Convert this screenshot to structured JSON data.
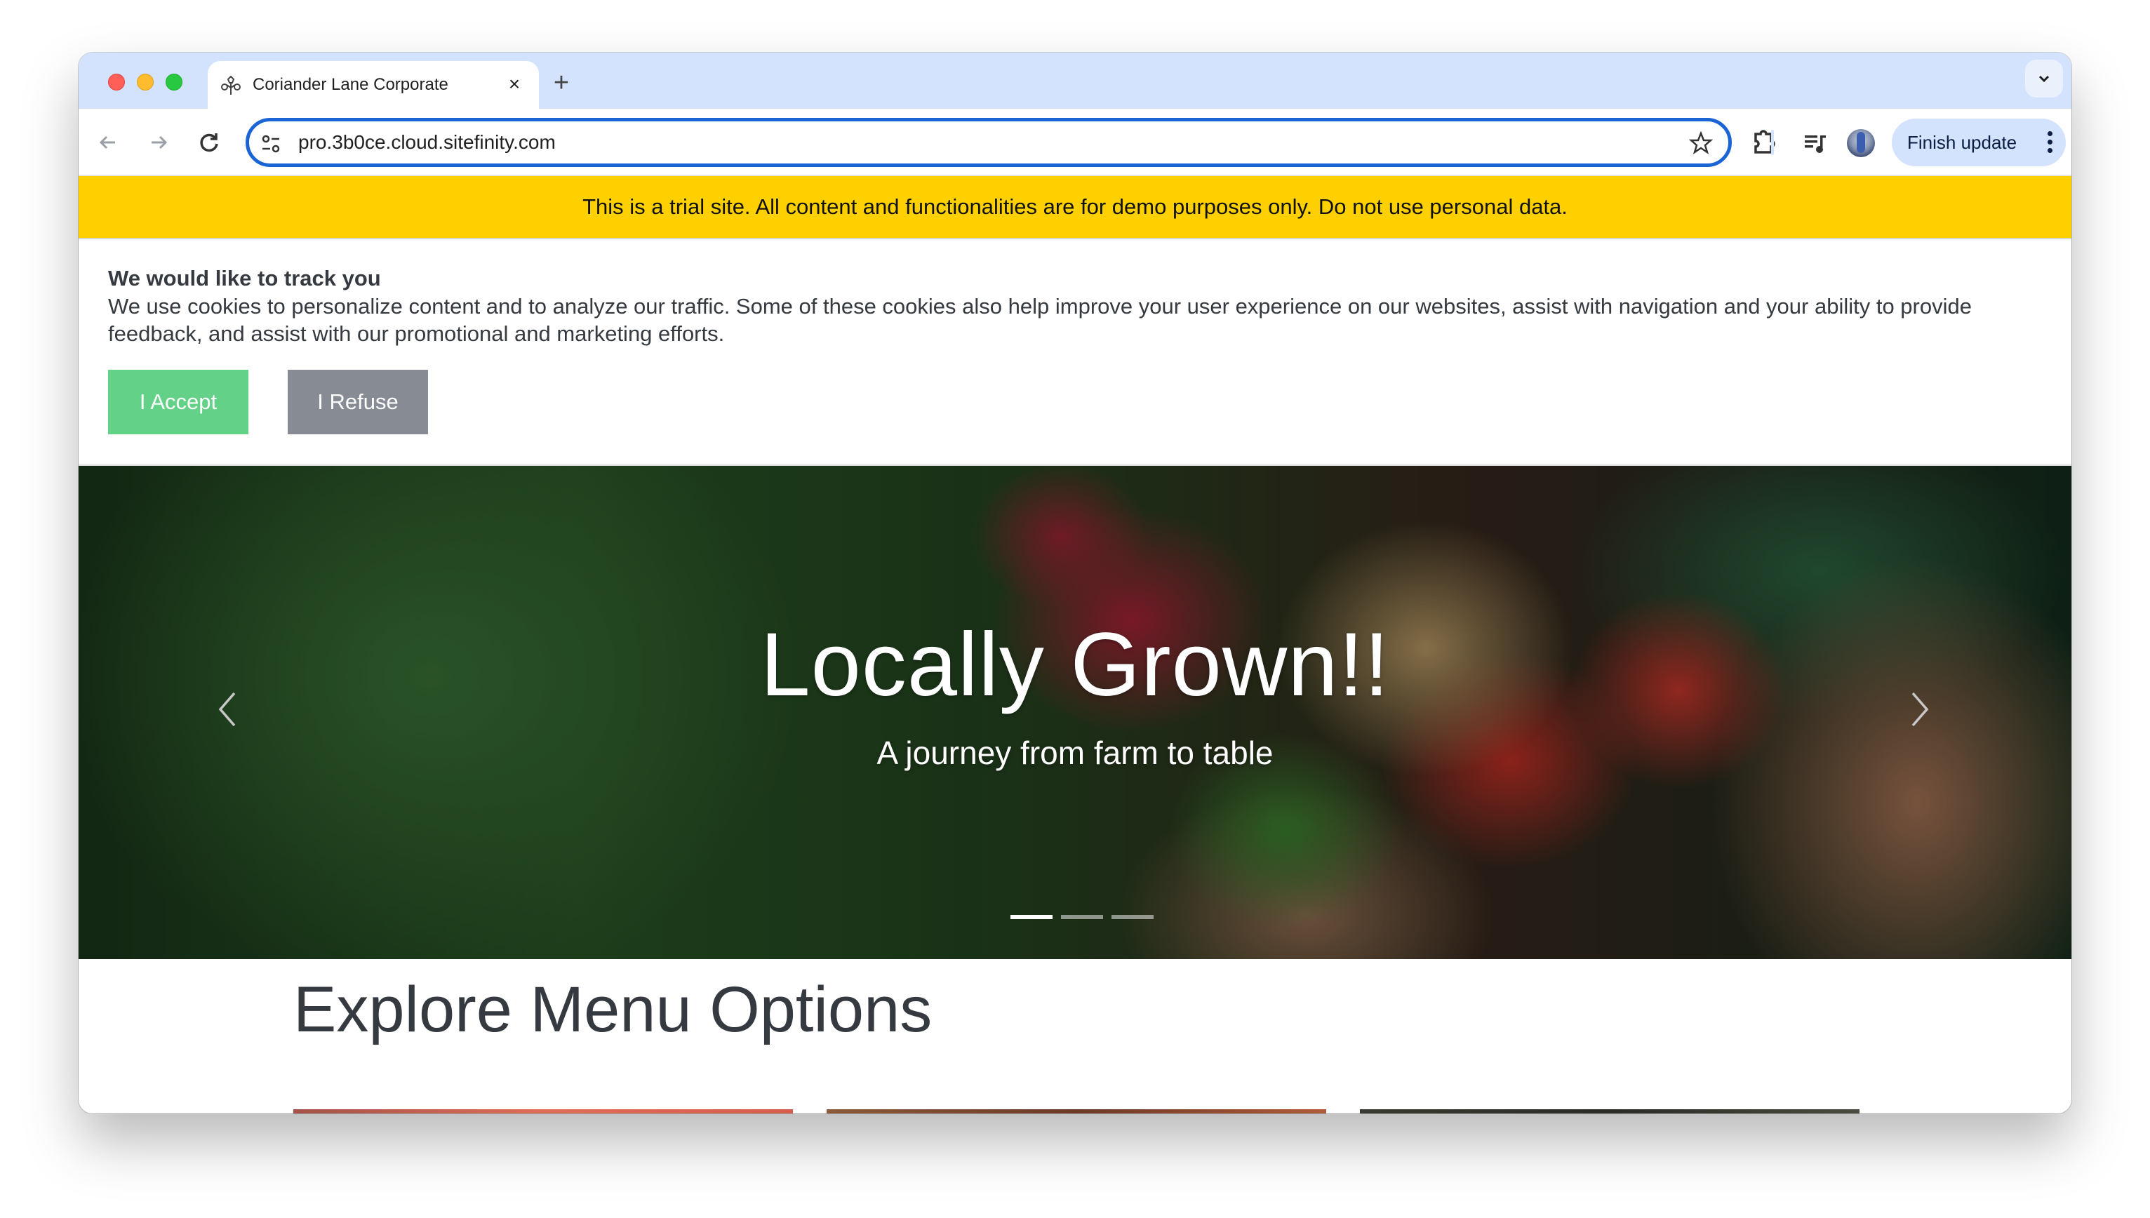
{
  "browser": {
    "tab": {
      "title": "Coriander Lane Corporate",
      "favicon": "coriander-logo-icon",
      "close_icon": "close-icon"
    },
    "new_tab_icon": "plus-icon",
    "tab_search_icon": "chevron-down-icon",
    "toolbar": {
      "back_icon": "arrow-left-icon",
      "forward_icon": "arrow-right-icon",
      "reload_icon": "reload-icon",
      "site_info_icon": "tune-icon",
      "url": "pro.3b0ce.cloud.sitefinity.com",
      "bookmark_icon": "star-icon",
      "extensions_icon": "puzzle-icon",
      "media_icon": "playlist-music-icon",
      "profile_icon": "avatar",
      "finish_update_label": "Finish update",
      "menu_icon": "more-vertical-icon"
    },
    "colors": {
      "tabstrip": "#d3e3fd",
      "omnibox_focus": "#1a64d6",
      "finish_update_bg": "#d3e3fd"
    }
  },
  "page": {
    "trial_banner": {
      "text": "This is a trial site. All content and functionalities are for demo purposes only. Do not use personal data.",
      "color": "#ffd000"
    },
    "cookie_consent": {
      "title": "We would like to track you",
      "text": "We use cookies to personalize content and to analyze our traffic. Some of these cookies also help improve your user experience on our websites, assist with navigation and your ability to provide feedback, and assist with our promotional and marketing efforts.",
      "accept_label": "I Accept",
      "refuse_label": "I Refuse",
      "accept_color": "#63d187",
      "refuse_color": "#878c94"
    },
    "hero": {
      "title": "Locally Grown!!",
      "subtitle": "A journey from farm to table",
      "prev_icon": "chevron-left-icon",
      "next_icon": "chevron-right-icon",
      "slides": 3,
      "active_slide": 1
    },
    "explore": {
      "title": "Explore Menu Options",
      "cards_visible": 3
    }
  }
}
